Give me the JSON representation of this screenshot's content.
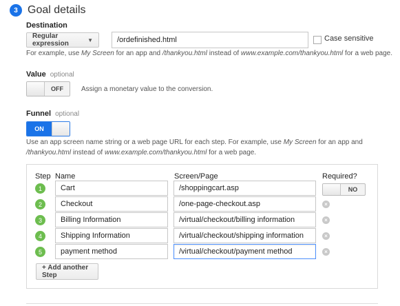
{
  "section": {
    "step_number": "3",
    "title": "Goal details"
  },
  "destination": {
    "label": "Destination",
    "match_type": "Regular expression",
    "value": "/ordefinished.html",
    "case_sensitive_label": "Case sensitive",
    "case_sensitive_checked": false,
    "help": {
      "p1": "For example, use ",
      "e1": "My Screen",
      "p2": " for an app and ",
      "e2": "/thankyou.html",
      "p3": " instead of ",
      "e3": "www.example.com/thankyou.html",
      "p4": " for a web page."
    }
  },
  "value": {
    "label": "Value",
    "optional": "optional",
    "toggle_state": "OFF",
    "description": "Assign a monetary value to the conversion."
  },
  "funnel": {
    "label": "Funnel",
    "optional": "optional",
    "toggle_state": "ON",
    "help": {
      "p1": "Use an app screen name string or a web page URL for each step. For example, use ",
      "e1": "My Screen",
      "p2": " for an app and ",
      "e2": "/thankyou.html",
      "p3": " instead of ",
      "e3": "www.example.com/thankyou.html",
      "p4": " for a web page."
    },
    "columns": {
      "step": "Step",
      "name": "Name",
      "screen": "Screen/Page",
      "required": "Required?"
    },
    "required_toggle_state": "NO",
    "steps": [
      {
        "number": "1",
        "name": "Cart",
        "screen": "/shoppingcart.asp"
      },
      {
        "number": "2",
        "name": "Checkout",
        "screen": "/one-page-checkout.asp"
      },
      {
        "number": "3",
        "name": "Billing Information",
        "screen": "/virtual/checkout/billing information"
      },
      {
        "number": "4",
        "name": "Shipping Information",
        "screen": "/virtual/checkout/shipping information"
      },
      {
        "number": "5",
        "name": "payment method",
        "screen": "/virtual/checkout/payment method"
      }
    ],
    "add_step_label": "+ Add another Step"
  },
  "icons": {
    "caret": "▼",
    "remove": "×"
  },
  "colors": {
    "accent_blue": "#1a73e8",
    "step_green": "#6dbd4f",
    "remove_gray": "#c9c9c9"
  }
}
